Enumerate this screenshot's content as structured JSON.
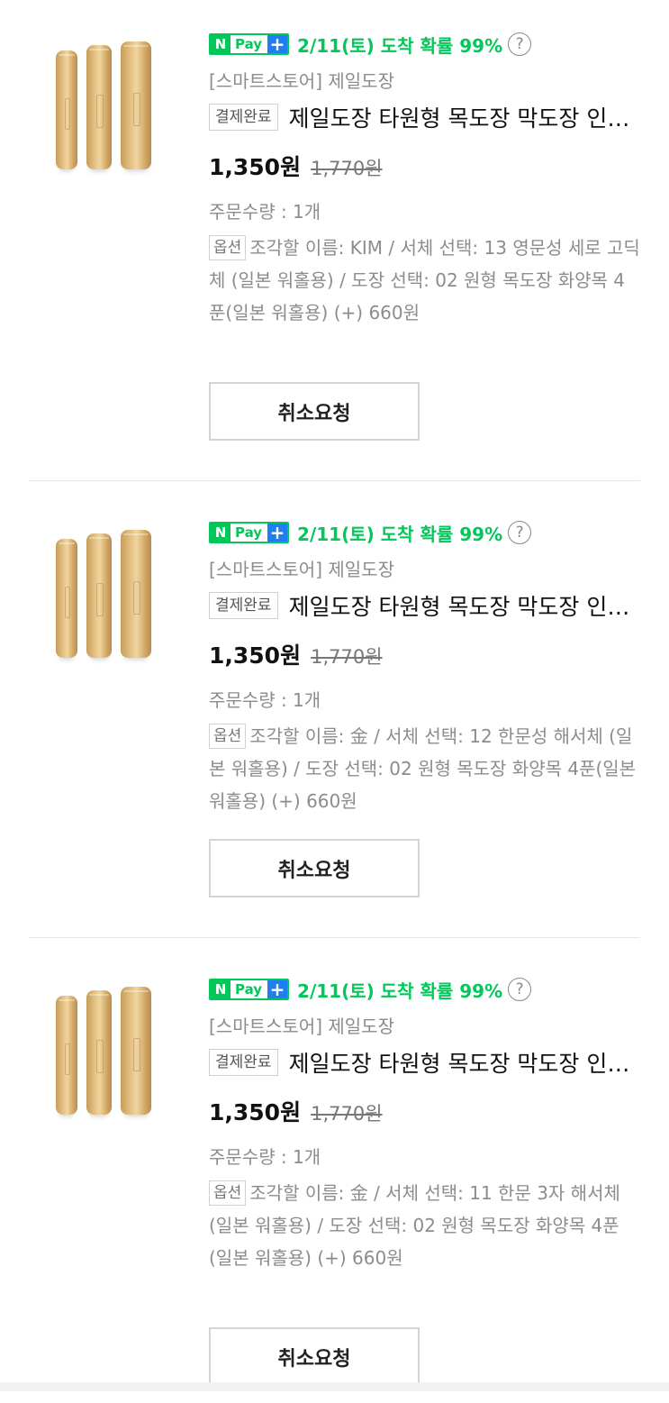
{
  "orders": [
    {
      "npay_n": "N",
      "npay_pay": "Pay",
      "npay_plus": "+",
      "delivery": "2/11(토) 도착 확률 99%",
      "help_glyph": "?",
      "store": "[스마트스토어] 제일도장",
      "status": "결제완료",
      "title": "제일도장 타원형 목도장 막도장 인감도장",
      "price": "1,350원",
      "original_price": "1,770원",
      "quantity": "주문수량 : 1개",
      "option_label": "옵션",
      "option_text": "조각할 이름: KIM / 서체 선택: 13 영문성 세로 고딕체 (일본 워홀용) / 도장 선택: 02 원형 목도장 화양목 4푼(일본 워홀용) (+) 660원",
      "cancel_label": "취소요청"
    },
    {
      "npay_n": "N",
      "npay_pay": "Pay",
      "npay_plus": "+",
      "delivery": "2/11(토) 도착 확률 99%",
      "help_glyph": "?",
      "store": "[스마트스토어] 제일도장",
      "status": "결제완료",
      "title": "제일도장 타원형 목도장 막도장 인감도장",
      "price": "1,350원",
      "original_price": "1,770원",
      "quantity": "주문수량 : 1개",
      "option_label": "옵션",
      "option_text": "조각할 이름: 金 / 서체 선택: 12 한문성 해서체 (일본 워홀용) / 도장 선택: 02 원형 목도장 화양목 4푼(일본 워홀용) (+) 660원",
      "cancel_label": "취소요청"
    },
    {
      "npay_n": "N",
      "npay_pay": "Pay",
      "npay_plus": "+",
      "delivery": "2/11(토) 도착 확률 99%",
      "help_glyph": "?",
      "store": "[스마트스토어] 제일도장",
      "status": "결제완료",
      "title": "제일도장 타원형 목도장 막도장 인감도장",
      "price": "1,350원",
      "original_price": "1,770원",
      "quantity": "주문수량 : 1개",
      "option_label": "옵션",
      "option_text": "조각할 이름: 金            / 서체 선택: 11 한문 3자 해서체 (일본 워홀용) / 도장 선택: 02 원형 목도장 화양목 4푼(일본 워홀용) (+) 660원",
      "cancel_label": "취소요청"
    }
  ],
  "colors": {
    "npay_green": "#03c75a",
    "npay_plus_blue": "#1f7ef0",
    "muted_text": "#8c8c8c"
  },
  "icons": {
    "help": "question-circle-icon",
    "product": "wooden-stamp-image"
  }
}
